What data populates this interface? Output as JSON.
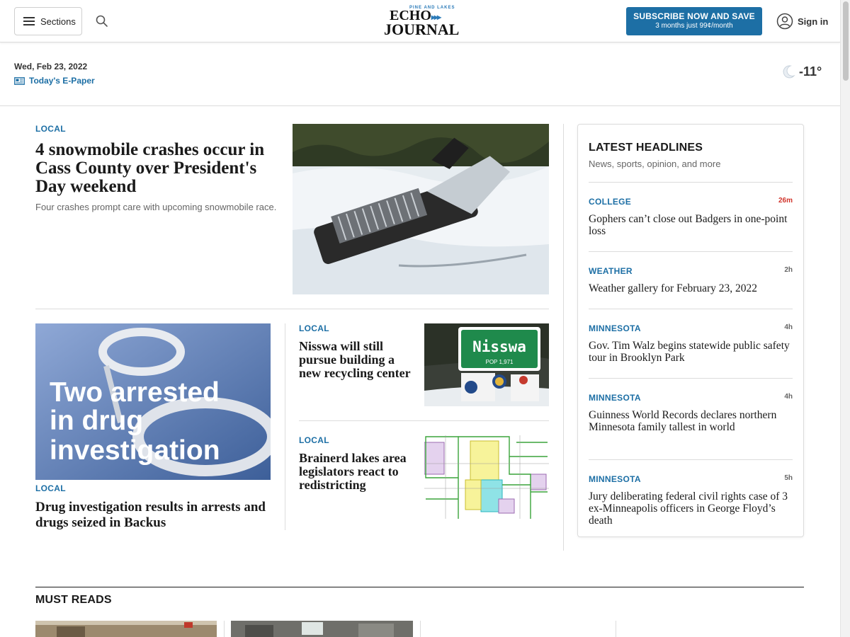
{
  "header": {
    "sections_label": "Sections",
    "logo_small": "PINE AND LAKES",
    "logo_echo": "ECHO",
    "logo_arrows": "▸▸▸",
    "logo_journal": "JOURNAL",
    "subscribe_line1": "SUBSCRIBE NOW AND SAVE",
    "subscribe_line2": "3 months just 99¢/month",
    "signin_label": "Sign in"
  },
  "datebar": {
    "date": "Wed, Feb 23, 2022",
    "epaper_label": "Today's E-Paper",
    "temperature": "-11°"
  },
  "lead": {
    "kicker": "LOCAL",
    "headline": "4 snowmobile crashes occur in Cass County over President's Day weekend",
    "summary": "Four crashes prompt care with upcoming snowmobile race."
  },
  "card2": {
    "image_text_line1": "Two arrested",
    "image_text_line2": "in drug",
    "image_text_line3": "investigation",
    "kicker": "LOCAL",
    "headline": "Drug investigation results in arrests and drugs seized in Backus"
  },
  "card3": {
    "kicker": "LOCAL",
    "headline": "Nisswa will still pursue building a new recycling center",
    "sign_name": "Nisswa",
    "sign_pop": "POP 1,971"
  },
  "card4": {
    "kicker": "LOCAL",
    "headline": "Brainerd lakes area legislators react to redistricting"
  },
  "latest": {
    "title": "LATEST HEADLINES",
    "subtitle": "News, sports, opinion, and more",
    "items": [
      {
        "kicker": "COLLEGE",
        "time": "26m",
        "headline": "Gophers can’t close out Badgers in one-point loss"
      },
      {
        "kicker": "WEATHER",
        "time": "2h",
        "headline": "Weather gallery for February 23, 2022"
      },
      {
        "kicker": "MINNESOTA",
        "time": "4h",
        "headline": "Gov. Tim Walz begins statewide public safety tour in Brooklyn Park"
      },
      {
        "kicker": "MINNESOTA",
        "time": "4h",
        "headline": "Guinness World Records declares northern Minnesota family tallest in world"
      },
      {
        "kicker": "MINNESOTA",
        "time": "5h",
        "headline": "Jury deliberating federal civil rights case of 3 ex-Minneapolis officers in George Floyd’s death"
      }
    ]
  },
  "mustreads": {
    "title": "MUST READS"
  },
  "colors": {
    "accent": "#1d6fa5",
    "new_time": "#d1342b"
  }
}
